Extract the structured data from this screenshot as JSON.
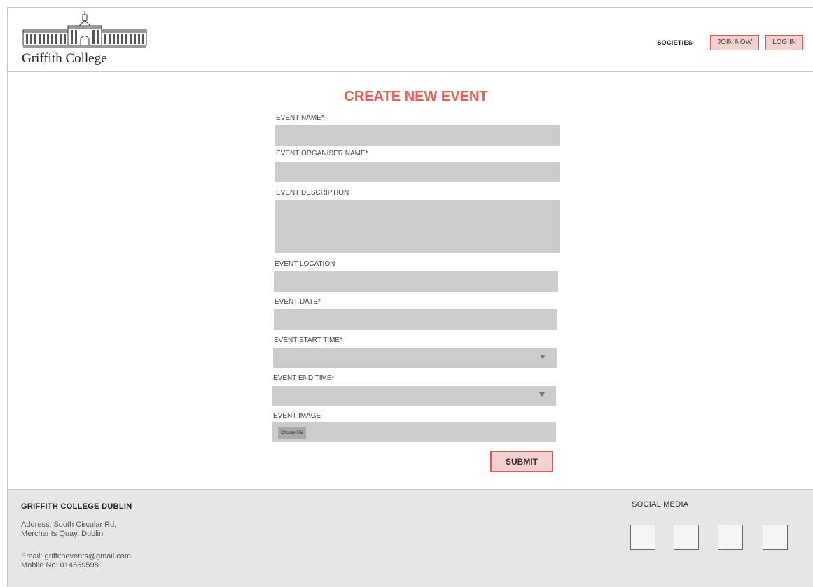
{
  "header": {
    "logo_text": "Griffith College",
    "nav": {
      "societies": "SOCIETIES",
      "join_now": "JOIN NOW",
      "log_in": "LOG IN"
    }
  },
  "form": {
    "title": "CREATE NEW EVENT",
    "event_name_label": "EVENT NAME*",
    "organiser_label": "EVENT ORGANISER NAME*",
    "description_label": "EVENT DESCRIPTION",
    "location_label": "EVENT LOCATION",
    "date_label": "EVENT DATE*",
    "start_time_label": "EVENT START TIME*",
    "end_time_label": "EVENT END TIME*",
    "image_label": "EVENT IMAGE",
    "choose_file": "Choose File",
    "submit": "SUBMIT"
  },
  "footer": {
    "college_name": "GRIFFITH COLLEGE DUBLIN",
    "address_line1": "Address: South Circular Rd,",
    "address_line2": "Merchants Quay, Dublin",
    "email": "Email: griffithevents@gmail.com",
    "mobile": "Mobile No: 014569598",
    "social_heading": "SOCIAL MEDIA",
    "social_icons": [
      "social-icon-1",
      "social-icon-2",
      "social-icon-3",
      "social-icon-4"
    ]
  },
  "colors": {
    "accent": "#f05a5a",
    "button_bg": "#f6cfcf",
    "button_border": "#d6595e",
    "field_bg": "#cccccc",
    "footer_bg": "#e6e6e6"
  }
}
